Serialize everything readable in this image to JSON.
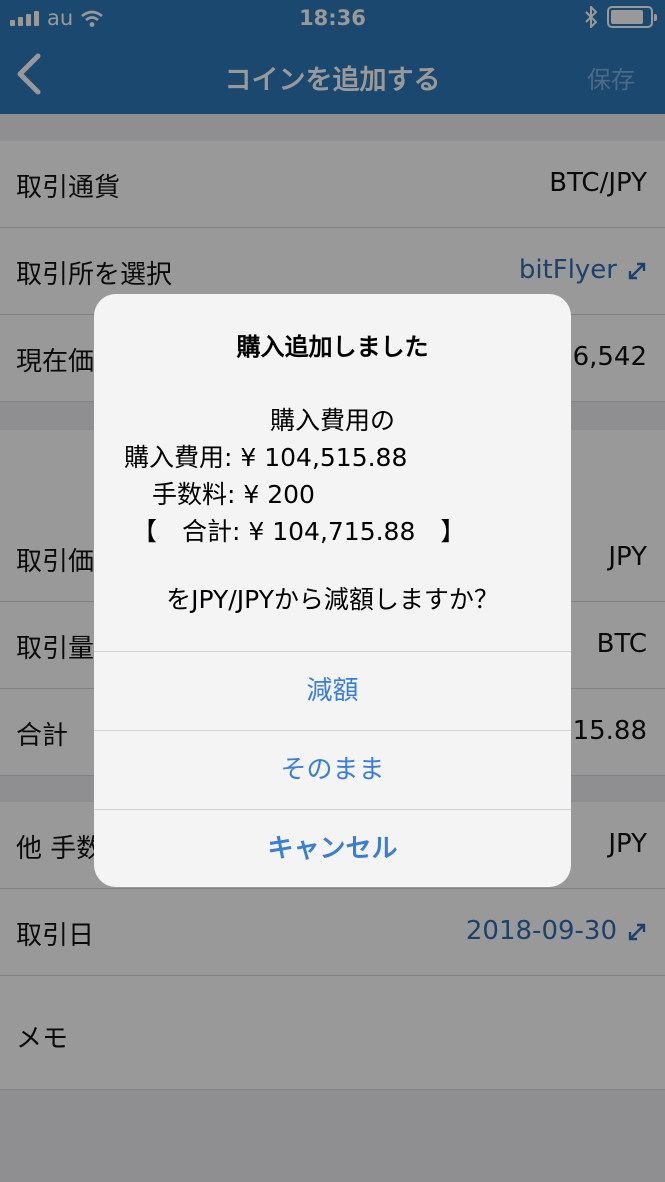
{
  "status_bar": {
    "carrier": "au",
    "time": "18:36"
  },
  "navbar": {
    "title": "コインを追加する",
    "save_label": "保存"
  },
  "rows": {
    "pair": {
      "label": "取引通貨",
      "value": "BTC/JPY"
    },
    "exchange": {
      "label": "取引所を選択",
      "value": "bitFlyer"
    },
    "price_now": {
      "label": "現在価",
      "value": "6,542"
    },
    "trade_price": {
      "label": "取引価",
      "value": "JPY"
    },
    "trade_qty": {
      "label": "取引量",
      "value": "BTC"
    },
    "total": {
      "label": "合計",
      "value": "15.88"
    },
    "fee_other": {
      "label": "他 手数",
      "value": "JPY"
    },
    "trade_date": {
      "label": "取引日",
      "value": "2018-09-30"
    },
    "memo": {
      "label": "メモ"
    }
  },
  "alert": {
    "title": "購入追加しました",
    "message_lines": [
      "購入費用の",
      "購入費用: ¥ 104,515.88",
      "手数料: ¥ 200",
      "【　合計: ¥ 104,715.88　】"
    ],
    "question": "をJPY/JPYから減額しますか？",
    "buttons": {
      "reduce": "減額",
      "keep": "そのまま",
      "cancel": "キャンセル"
    }
  },
  "colors": {
    "navbar": "#2c78b8",
    "link": "#2f6fb4",
    "alert_button": "#3a7ed6"
  },
  "icons": [
    "signal-icon",
    "wifi-icon",
    "bluetooth-icon",
    "battery-icon",
    "back-chevron-icon",
    "external-link-icon"
  ]
}
